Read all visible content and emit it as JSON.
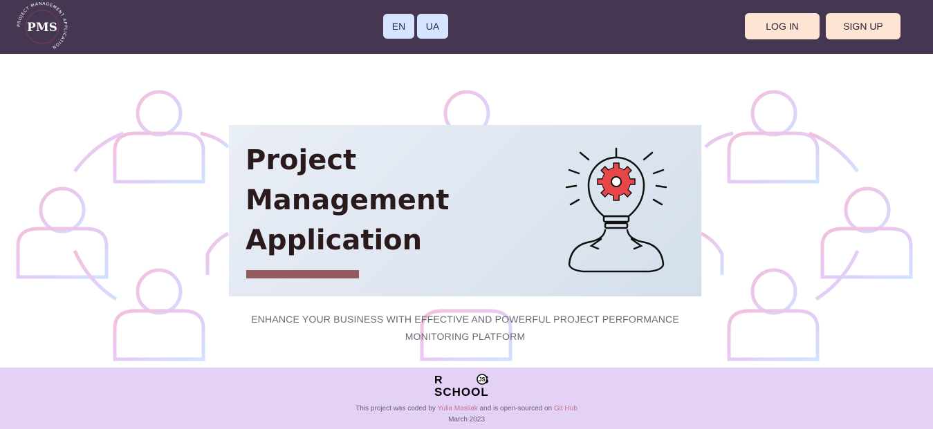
{
  "header": {
    "logo_text": "PMS",
    "logo_ring_text": "PROJECT MANAGEMENT APPLICATION",
    "languages": [
      "EN",
      "UA"
    ],
    "login_label": "LOG IN",
    "signup_label": "SIGN UP"
  },
  "hero": {
    "title_lines": [
      "Project",
      "Management",
      "Application"
    ],
    "tagline": "ENHANCE YOUR BUSINESS WITH EFFECTIVE AND POWERFUL PROJECT PERFORMANCE MONITORING PLATFORM"
  },
  "footer": {
    "logo_line1": "R S",
    "logo_line2": "SCHOOL",
    "logo_badge": "JS",
    "credits_prefix": "This project was coded by",
    "author": "Yulia Masliak",
    "credits_middle": "and is open-sourced on",
    "repo_link": "Git Hub",
    "date": "March 2023"
  },
  "colors": {
    "header_bg": "#453651",
    "lang_button_bg": "#d6e4ff",
    "auth_button_bg": "#fde4d3",
    "footer_bg": "#e4d1f6",
    "hero_bar": "#955a5d",
    "link": "#c2768d"
  }
}
